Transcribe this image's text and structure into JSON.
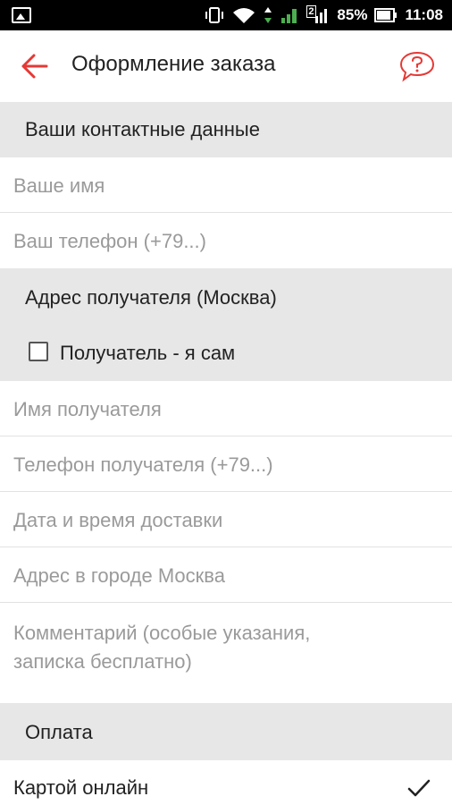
{
  "statusbar": {
    "battery": "85%",
    "time": "11:08",
    "sim_number": "2"
  },
  "appbar": {
    "title": "Оформление заказа",
    "accent_color": "#e53935"
  },
  "contact_section": {
    "title": "Ваши контактные данные",
    "name_placeholder": "Ваше имя",
    "phone_placeholder": "Ваш телефон (+79...)"
  },
  "recipient_section": {
    "title": "Адрес получателя (Москва)",
    "self_checkbox_label": "Получатель - я сам",
    "self_checked": false,
    "name_placeholder": "Имя получателя",
    "phone_placeholder": "Телефон получателя (+79...)",
    "datetime_placeholder": "Дата и время доставки",
    "address_placeholder": "Адрес в городе Москва",
    "comment_placeholder_line1": "Комментарий (особые указания,",
    "comment_placeholder_line2": "записка бесплатно)"
  },
  "payment_section": {
    "title": "Оплата",
    "option_label": "Картой онлайн",
    "option_selected": true
  },
  "icons": {
    "gallery": "image-icon",
    "vibrate": "vibrate-icon",
    "wifi": "wifi-icon",
    "signal": "signal-icon",
    "battery": "battery-icon",
    "back": "arrow-left-icon",
    "help": "help-bubble-icon",
    "check": "checkmark-icon"
  }
}
